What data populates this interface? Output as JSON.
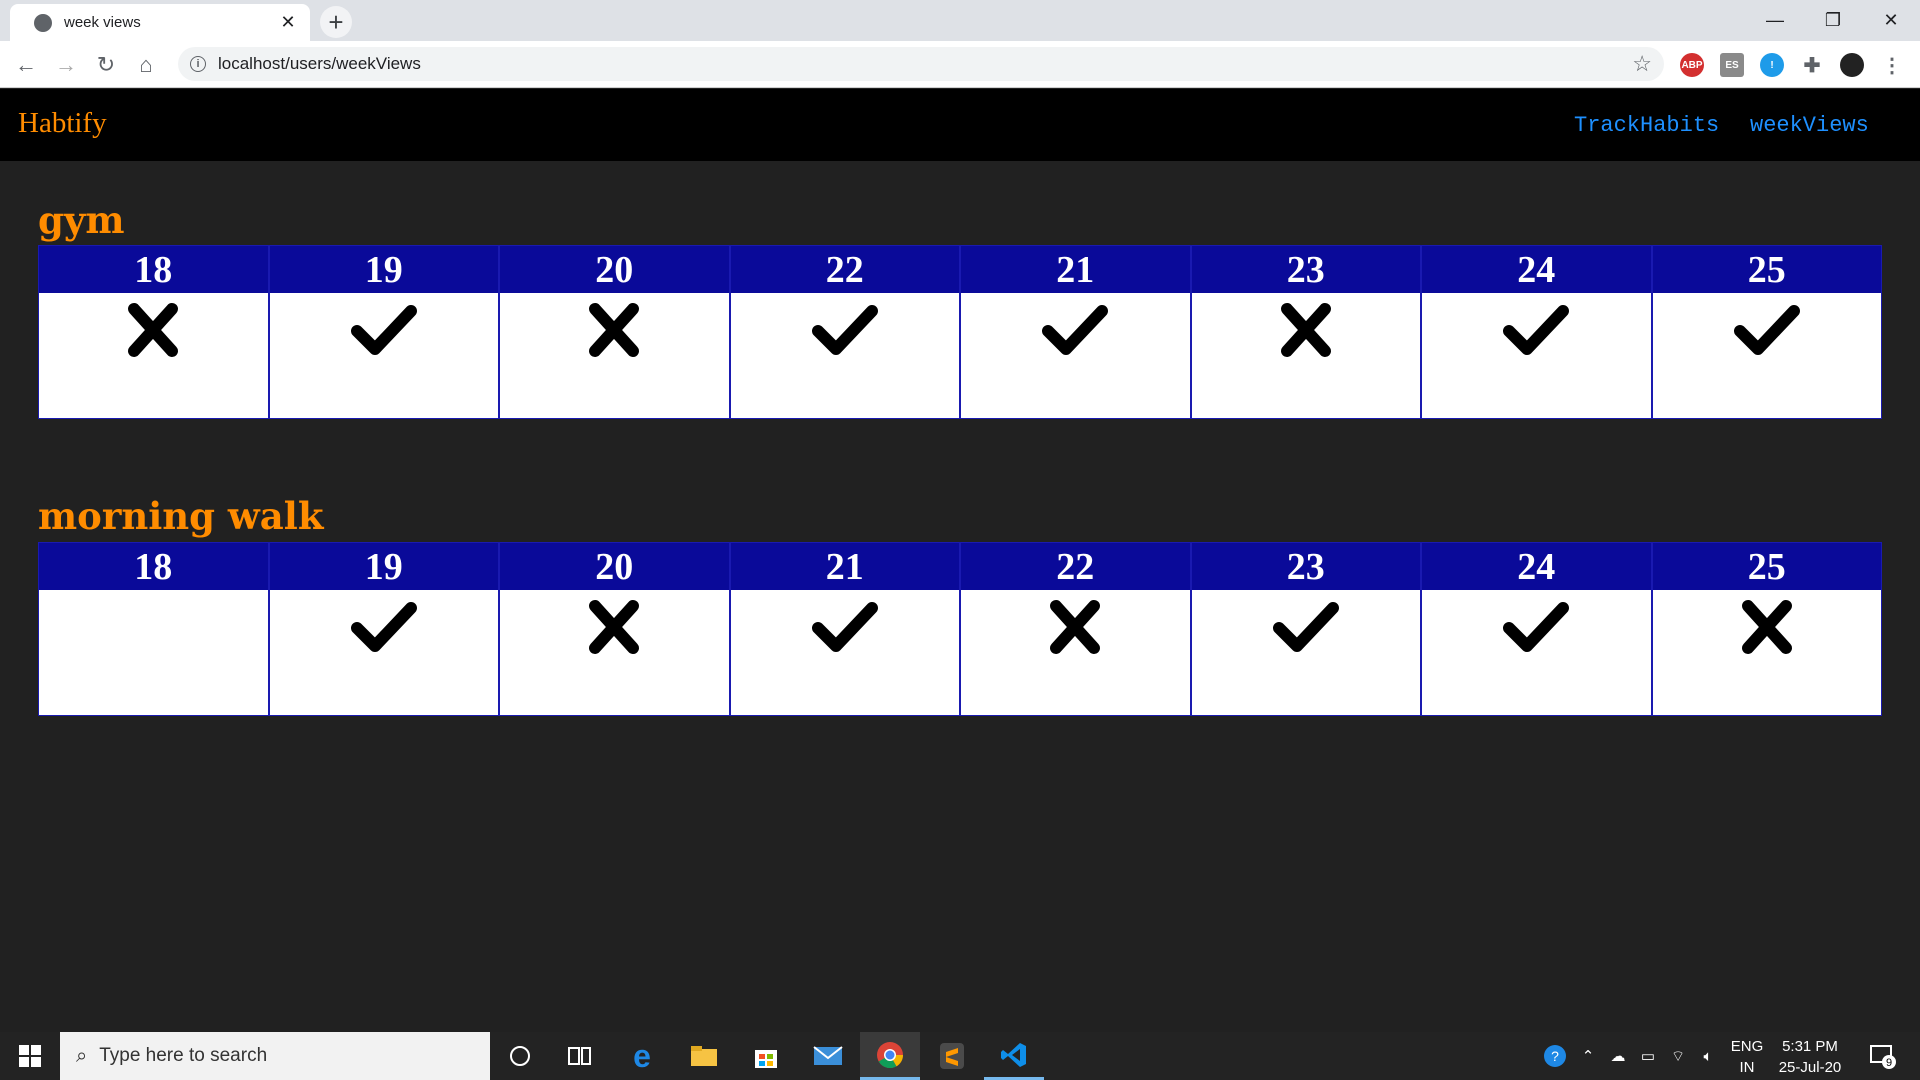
{
  "browser": {
    "tab_title": "week views",
    "url": "localhost/users/weekViews"
  },
  "nav": {
    "brand": "Habtify",
    "links": [
      "TrackHabits",
      "weekViews"
    ]
  },
  "habits": [
    {
      "name": "gym",
      "days": [
        {
          "date": "18",
          "status": "no"
        },
        {
          "date": "19",
          "status": "done"
        },
        {
          "date": "20",
          "status": "no"
        },
        {
          "date": "22",
          "status": "done"
        },
        {
          "date": "21",
          "status": "done"
        },
        {
          "date": "23",
          "status": "no"
        },
        {
          "date": "24",
          "status": "done"
        },
        {
          "date": "25",
          "status": "done"
        }
      ]
    },
    {
      "name": "morning walk",
      "days": [
        {
          "date": "18",
          "status": "none"
        },
        {
          "date": "19",
          "status": "done"
        },
        {
          "date": "20",
          "status": "no"
        },
        {
          "date": "21",
          "status": "done"
        },
        {
          "date": "22",
          "status": "no"
        },
        {
          "date": "23",
          "status": "done"
        },
        {
          "date": "24",
          "status": "done"
        },
        {
          "date": "25",
          "status": "no"
        }
      ]
    }
  ],
  "taskbar": {
    "search_placeholder": "Type here to search",
    "lang_line1": "ENG",
    "lang_line2": "IN",
    "time": "5:31 PM",
    "date": "25-Jul-20",
    "notification_count": "9"
  }
}
